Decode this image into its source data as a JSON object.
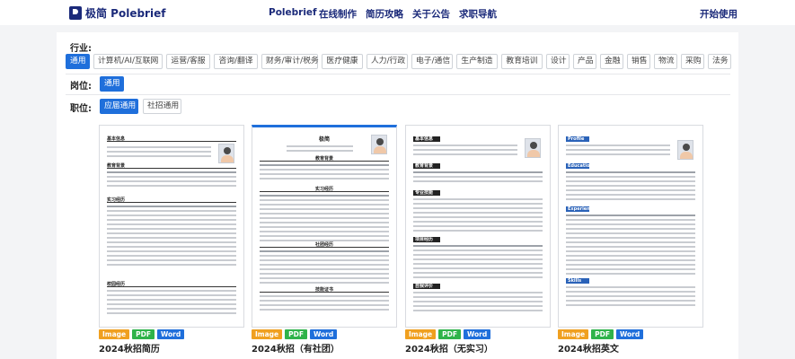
{
  "nav": {
    "brand": "极简 Polebrief",
    "links": [
      "Polebrief",
      "在线制作",
      "简历攻略",
      "关于公告",
      "求职导航"
    ],
    "cta": "开始使用"
  },
  "filters": {
    "industry": {
      "label": "行业:",
      "options": [
        "通用",
        "计算机/AI/互联网",
        "运营/客服",
        "咨询/翻译",
        "财务/审计/税务",
        "医疗健康",
        "人力/行政",
        "电子/通信",
        "生产制造",
        "教育培训",
        "设计",
        "产品",
        "金融",
        "销售",
        "物流",
        "采购",
        "法务"
      ],
      "selected": "通用"
    },
    "position": {
      "label": "岗位:",
      "options": [
        "通用"
      ],
      "selected": "通用"
    },
    "stage": {
      "label": "职位:",
      "options": [
        "应届通用",
        "社招通用"
      ],
      "selected": "应届通用"
    }
  },
  "templates": [
    {
      "title": "2024秋招简历",
      "tags": [
        "Image",
        "PDF",
        "Word"
      ],
      "selected": false
    },
    {
      "title": "2024秋招（有社团）",
      "tags": [
        "Image",
        "PDF",
        "Word"
      ],
      "selected": true
    },
    {
      "title": "2024秋招（无实习）",
      "tags": [
        "Image",
        "PDF",
        "Word"
      ],
      "selected": false
    },
    {
      "title": "2024秋招英文",
      "tags": [
        "Image",
        "PDF",
        "Word"
      ],
      "selected": false
    }
  ],
  "resume_preview": {
    "t1_section_1": "基本信息",
    "t1_section_2": "教育背景",
    "t1_section_3": "实习经历",
    "t1_section_4": "校园经历",
    "t2_name": "极简",
    "t2_section_1": "教育背景",
    "t2_section_2": "实习经历",
    "t2_section_3": "社团经历",
    "t2_section_4": "技能证书",
    "t3_section_1": "基本信息",
    "t3_section_2": "教育背景",
    "t3_section_3": "专业技能",
    "t3_section_4": "项目经历",
    "t3_section_5": "自我评价",
    "t4_section_1": "Profile",
    "t4_section_2": "Education",
    "t4_section_3": "Experience",
    "t4_section_4": "Skills"
  }
}
